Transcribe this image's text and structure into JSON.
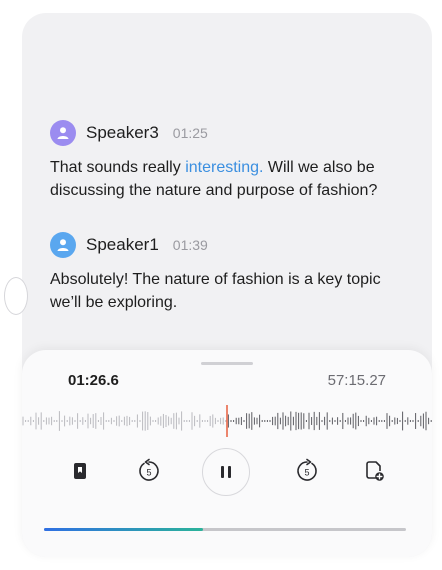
{
  "messages": [
    {
      "speaker": "Speaker3",
      "time": "01:25",
      "avatar_color": "#9b8cf0",
      "text_before": "That sounds really ",
      "text_highlight": "interesting.",
      "text_after": " Will we also be discussing the nature and purpose of fashion?"
    },
    {
      "speaker": "Speaker1",
      "time": "01:39",
      "avatar_color": "#5aa7ef",
      "text_before": "Absolutely! The nature of fashion is a key topic we’ll be exploring.",
      "text_highlight": "",
      "text_after": ""
    }
  ],
  "player": {
    "current_time": "01:26.6",
    "total_time": "57:15.27",
    "progress_fraction": 0.44,
    "playhead_color": "#e8684a",
    "controls": [
      {
        "name": "bookmark-icon",
        "label": ""
      },
      {
        "name": "rewind-5-icon",
        "label": "5"
      },
      {
        "name": "pause-icon",
        "label": ""
      },
      {
        "name": "forward-5-icon",
        "label": "5"
      },
      {
        "name": "add-note-icon",
        "label": ""
      }
    ]
  }
}
